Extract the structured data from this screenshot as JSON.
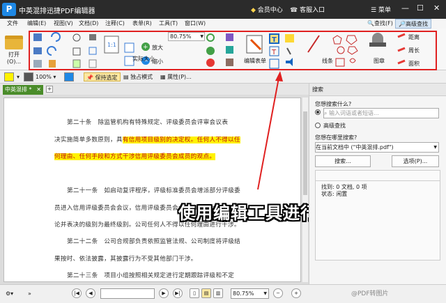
{
  "app": {
    "title": "中英混排迅捷PDF编辑器",
    "member": "会员中心",
    "client": "客服入口",
    "menu_label": "菜单"
  },
  "menu": {
    "items": [
      "文件",
      "编辑(E)",
      "视图(V)",
      "文档(D)",
      "注释(C)",
      "表单(R)",
      "工具(T)",
      "窗口(W)"
    ],
    "find": "查找(F)",
    "advanced_find": "高级查找"
  },
  "ribbon": {
    "open": "打开(O)...",
    "zoom_value": "80.75%",
    "actual_size": "实际大小",
    "zoom_in": "放大",
    "zoom_out": "缩小",
    "edit_form": "编辑表单",
    "line": "线条",
    "image": "图章",
    "distance": "距离",
    "perimeter": "周长",
    "area": "面积"
  },
  "toolbar2": {
    "zoom": "100%",
    "keep_selected": "保持选定",
    "exclusive_mode": "独占模式",
    "properties": "属性(P)..."
  },
  "tab": {
    "name": "中英混排 *"
  },
  "document": {
    "p1a": "第二十条　除监管机构有特殊规定、评级委员会评审会议表",
    "p1b_plain": "决实施简单多数原则，具",
    "p1b_hl": "有信用项目级别的决定权。任何人不得以任",
    "p1c_hl": "何理由、任何手段和方式干涉信用评级委员会成员的观点。",
    "p2a": "第二十一条　如启动复评程序，评级标准委员会增派部分评级委",
    "p2b": "员进入信用评级委员会会议，信用评级委员会会议的决定为最终",
    "p2c": "论并表决的级别为最终级别。公司任何人不得以任何理由进行干涉。",
    "p3a": "第二十二条　公司合规部负责依照监管法规、公司制度将评级结",
    "p3b": "果按时、依法披露，其披露行为不受其他部门干涉。",
    "p4a": "第二十三条　项目小组按照相关规定进行定期跟踪评级和不定"
  },
  "overlay_caption": "使用编辑工具进行编辑",
  "statusbar": {
    "zoom": "80.75%"
  },
  "search_panel": {
    "title": "搜索",
    "what_label": "您想搜索什么?",
    "input_placeholder": "输入词语或者短语...",
    "advanced": "高级查找",
    "where_label": "您想在哪里搜索?",
    "where_value": "在当前文档中 (\"中英混排.pdf\")",
    "search_btn": "搜索...",
    "options_btn": "选项(P)...",
    "found": "找到: 0 文档, 0 项",
    "status": "状态: 闲置"
  },
  "watermark": "@PDF转图片",
  "colors": {
    "highlight": "#fff200",
    "highlight_text": "#c01010",
    "annotation_box": "#e02020",
    "tab_green": "#4a8c2a",
    "titlebar": "#2b2b2b"
  }
}
